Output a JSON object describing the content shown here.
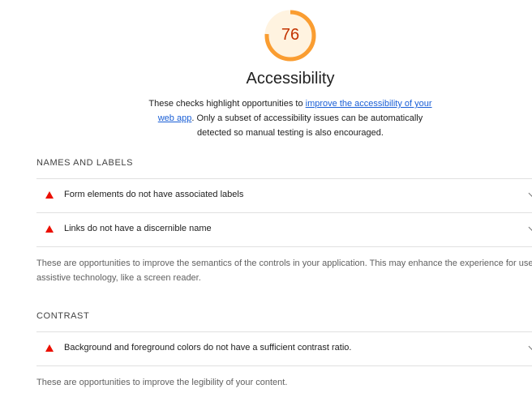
{
  "category": {
    "score": "76",
    "score_fraction": 0.76,
    "score_color": "#fa9d31",
    "title": "Accessibility",
    "description_before": "These checks highlight opportunities to ",
    "description_link": "improve the accessibility of your web app",
    "description_after": ". Only a subset of accessibility issues can be automatically detected so manual testing is also encouraged."
  },
  "groups": [
    {
      "title": "NAMES AND LABELS",
      "audits": [
        {
          "title": "Form elements do not have associated labels",
          "status": "fail"
        },
        {
          "title": "Links do not have a discernible name",
          "status": "fail"
        }
      ],
      "description": "These are opportunities to improve the semantics of the controls in your application. This may enhance the experience for users of assistive technology, like a screen reader."
    },
    {
      "title": "CONTRAST",
      "audits": [
        {
          "title": "Background and foreground colors do not have a sufficient contrast ratio.",
          "status": "fail"
        }
      ],
      "description": "These are opportunities to improve the legibility of your content."
    }
  ],
  "colors": {
    "fail": "#eb0f00",
    "link": "#1a5fd6",
    "gauge_track": "#fff3e0"
  }
}
